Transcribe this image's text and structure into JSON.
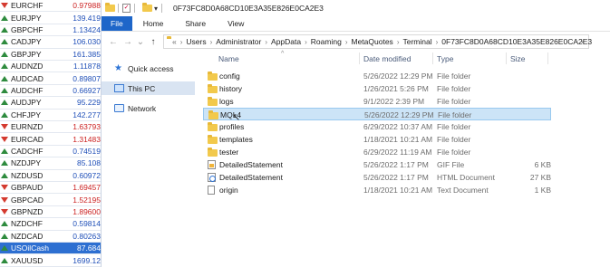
{
  "market_watch": {
    "rows": [
      {
        "symbol": "EURCHF",
        "price": "0.97988",
        "dir": "down",
        "price_color": "red"
      },
      {
        "symbol": "EURJPY",
        "price": "139.419",
        "dir": "up",
        "price_color": "blue"
      },
      {
        "symbol": "GBPCHF",
        "price": "1.13424",
        "dir": "up",
        "price_color": "blue"
      },
      {
        "symbol": "CADJPY",
        "price": "106.030",
        "dir": "up",
        "price_color": "blue"
      },
      {
        "symbol": "GBPJPY",
        "price": "161.385",
        "dir": "up",
        "price_color": "blue"
      },
      {
        "symbol": "AUDNZD",
        "price": "1.11878",
        "dir": "up",
        "price_color": "blue"
      },
      {
        "symbol": "AUDCAD",
        "price": "0.89807",
        "dir": "up",
        "price_color": "blue"
      },
      {
        "symbol": "AUDCHF",
        "price": "0.66927",
        "dir": "up",
        "price_color": "blue"
      },
      {
        "symbol": "AUDJPY",
        "price": "95.229",
        "dir": "up",
        "price_color": "blue"
      },
      {
        "symbol": "CHFJPY",
        "price": "142.277",
        "dir": "up",
        "price_color": "blue"
      },
      {
        "symbol": "EURNZD",
        "price": "1.63793",
        "dir": "down",
        "price_color": "red"
      },
      {
        "symbol": "EURCAD",
        "price": "1.31483",
        "dir": "down",
        "price_color": "red"
      },
      {
        "symbol": "CADCHF",
        "price": "0.74519",
        "dir": "up",
        "price_color": "blue"
      },
      {
        "symbol": "NZDJPY",
        "price": "85.108",
        "dir": "up",
        "price_color": "blue"
      },
      {
        "symbol": "NZDUSD",
        "price": "0.60972",
        "dir": "up",
        "price_color": "blue"
      },
      {
        "symbol": "GBPAUD",
        "price": "1.69457",
        "dir": "down",
        "price_color": "red"
      },
      {
        "symbol": "GBPCAD",
        "price": "1.52195",
        "dir": "down",
        "price_color": "red"
      },
      {
        "symbol": "GBPNZD",
        "price": "1.89600",
        "dir": "down",
        "price_color": "red"
      },
      {
        "symbol": "NZDCHF",
        "price": "0.59814",
        "dir": "up",
        "price_color": "blue"
      },
      {
        "symbol": "NZDCAD",
        "price": "0.80263",
        "dir": "up",
        "price_color": "blue"
      },
      {
        "symbol": "USOilCash",
        "price": "87.684",
        "dir": "up",
        "price_color": "blue",
        "selected": true
      },
      {
        "symbol": "XAUUSD",
        "price": "1699.12",
        "dir": "up",
        "price_color": "blue"
      }
    ]
  },
  "explorer": {
    "title": "0F73FC8D0A68CD10E3A35E826E0CA2E3",
    "check_glyph": "✓",
    "ribbon_tabs": [
      "File",
      "Home",
      "Share",
      "View"
    ],
    "nav": {
      "back": "←",
      "forward": "→",
      "recent": "⌄",
      "up": "↑"
    },
    "breadcrumb": [
      "«",
      "Users",
      "Administrator",
      "AppData",
      "Roaming",
      "MetaQuotes",
      "Terminal",
      "0F73FC8D0A68CD10E3A35E826E0CA2E3"
    ],
    "crumb_chevron": "›",
    "address_dropdown": "⌄",
    "nav_pane": [
      {
        "label": "Quick access",
        "icon": "star-icon"
      },
      {
        "label": "This PC",
        "icon": "pc-icon",
        "selected": true
      },
      {
        "label": "Network",
        "icon": "network-icon"
      }
    ],
    "columns": {
      "name": "Name",
      "date": "Date modified",
      "type": "Type",
      "size": "Size",
      "sort_glyph": "^"
    },
    "files": [
      {
        "name": "config",
        "date": "5/26/2022 12:29 PM",
        "type": "File folder",
        "size": "",
        "icon": "folder"
      },
      {
        "name": "history",
        "date": "1/26/2021 5:26 PM",
        "type": "File folder",
        "size": "",
        "icon": "folder"
      },
      {
        "name": "logs",
        "date": "9/1/2022 2:39 PM",
        "type": "File folder",
        "size": "",
        "icon": "folder"
      },
      {
        "name": "MQL4",
        "date": "5/26/2022 12:29 PM",
        "type": "File folder",
        "size": "",
        "icon": "folder",
        "selected": true
      },
      {
        "name": "profiles",
        "date": "6/29/2022 10:37 AM",
        "type": "File folder",
        "size": "",
        "icon": "folder"
      },
      {
        "name": "templates",
        "date": "1/18/2021 10:21 AM",
        "type": "File folder",
        "size": "",
        "icon": "folder"
      },
      {
        "name": "tester",
        "date": "6/29/2022 11:19 AM",
        "type": "File folder",
        "size": "",
        "icon": "folder"
      },
      {
        "name": "DetailedStatement",
        "date": "5/26/2022 1:17 PM",
        "type": "GIF File",
        "size": "6 KB",
        "icon": "gif"
      },
      {
        "name": "DetailedStatement",
        "date": "5/26/2022 1:17 PM",
        "type": "HTML Document",
        "size": "27 KB",
        "icon": "html"
      },
      {
        "name": "origin",
        "date": "1/18/2021 10:21 AM",
        "type": "Text Document",
        "size": "1 KB",
        "icon": "text"
      }
    ]
  },
  "colors": {
    "file_tab": "#1e66c9",
    "selection": "#cce4f7",
    "market_selection": "#2d6fd1"
  }
}
